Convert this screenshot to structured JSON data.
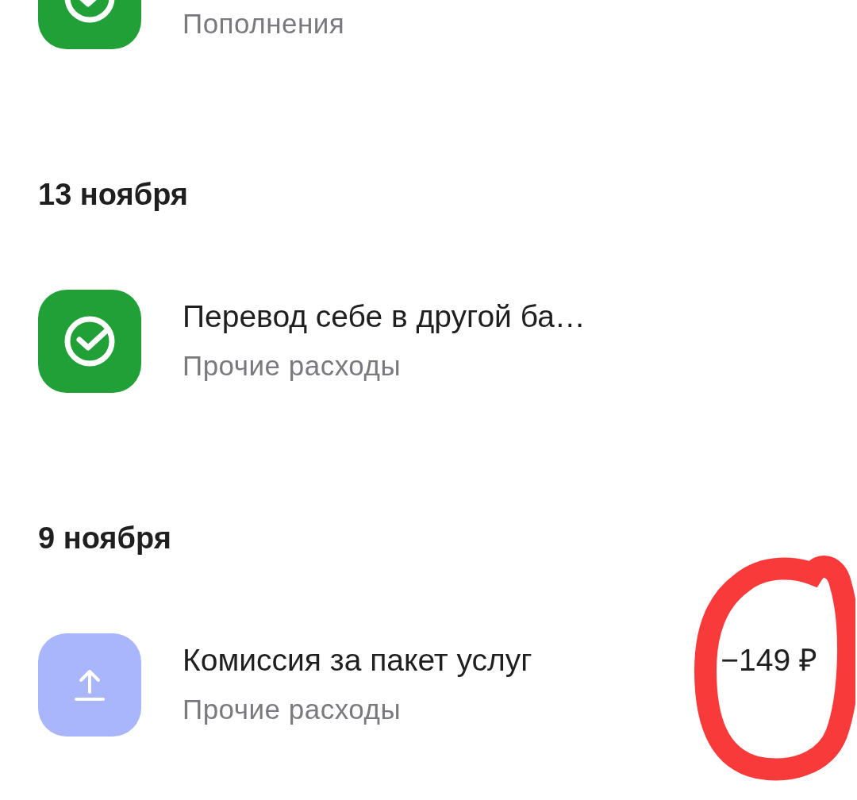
{
  "sections": [
    {
      "transactions": [
        {
          "kind": "check",
          "color": "#21a038",
          "subtitle": "Пополнения"
        }
      ]
    },
    {
      "date": "13 ноября",
      "transactions": [
        {
          "kind": "check",
          "color": "#21a038",
          "title": "Перевод себе в другой ба…",
          "subtitle": "Прочие расходы"
        }
      ]
    },
    {
      "date": "9 ноября",
      "transactions": [
        {
          "kind": "upload",
          "color": "#a9b6fb",
          "title": "Комиссия за пакет услуг",
          "subtitle": "Прочие расходы",
          "amount": "−149 ₽",
          "circled": true
        }
      ]
    }
  ]
}
